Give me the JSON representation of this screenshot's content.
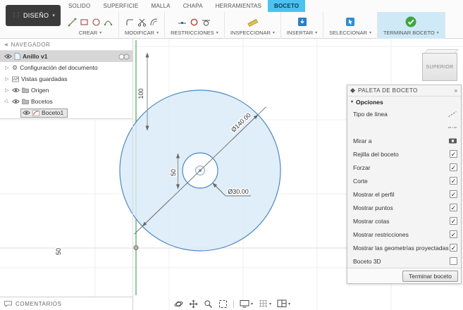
{
  "design_button": "DISEÑO",
  "tabs": [
    "SOLIDO",
    "SUPERFICIE",
    "MALLA",
    "CHAPA",
    "HERRAMIENTAS",
    "BOCETO"
  ],
  "active_tab": "BOCETO",
  "toolbar": {
    "groups": [
      {
        "label": "CREAR",
        "icons": [
          "line-icon",
          "rectangle-icon",
          "circle-icon",
          "arc-icon"
        ]
      },
      {
        "label": "MODIFICAR",
        "icons": [
          "fillet-icon",
          "trim-scissors-icon",
          "offset-icon"
        ]
      },
      {
        "label": "RESTRICCIONES",
        "icons": [
          "midpoint-constraint-icon",
          "coincident-constraint-icon",
          "tangent-constraint-icon"
        ]
      },
      {
        "label": "INSPECCIONAR",
        "icons": [
          "measure-icon"
        ]
      },
      {
        "label": "INSERTAR",
        "icons": [
          "insert-icon"
        ]
      },
      {
        "label": "SELECCIONAR",
        "icons": [
          "select-cursor-icon"
        ]
      },
      {
        "label": "TERMINAR BOCETO",
        "icons": [
          "finish-sketch-check-icon"
        ],
        "highlighted": true
      }
    ]
  },
  "navigator": {
    "title": "NAVEGADOR",
    "items": [
      {
        "label": "Anillo v1",
        "selected": true,
        "icons": [
          "eye-icon",
          "document-icon"
        ]
      },
      {
        "label": "Configuración del documento",
        "icons": [
          "gear-icon"
        ]
      },
      {
        "label": "Vistas guardadas",
        "icons": [
          "saved-views-icon"
        ]
      },
      {
        "label": "Origen",
        "icons": [
          "eye-icon",
          "folder-icon"
        ]
      },
      {
        "label": "Bocetos",
        "expanded": true,
        "icons": [
          "eye-icon",
          "folder-icon"
        ]
      },
      {
        "label": "Boceto1",
        "depth": 1,
        "active": true,
        "icons": [
          "eye-icon",
          "sketch-icon"
        ]
      }
    ]
  },
  "comments": {
    "title": "COMENTARIOS"
  },
  "viewcube": {
    "face": "SUPERIOR"
  },
  "canvas": {
    "dimensions": {
      "outer_diameter": "Ø140.00",
      "inner_diameter": "Ø30.00",
      "vertical_100": "100",
      "vertical_50": "50",
      "bottom_50": "50"
    },
    "accent_colors": {
      "profile_fill": "#d9ebf7",
      "geometry_stroke": "#4e88c0",
      "y_axis": "#46a758"
    }
  },
  "palette": {
    "title": "PALETA DE BOCETO",
    "section_title": "Opciones",
    "rows": [
      {
        "label": "Tipo de línea",
        "control": "construction-line-icon"
      },
      {
        "label": "",
        "control": "center-line-icon"
      },
      {
        "label": "Mirar a",
        "control": "look-at-icon"
      },
      {
        "label": "Rejilla del boceto",
        "checked": true,
        "mark": "✓"
      },
      {
        "label": "Forzar",
        "checked": true,
        "mark": "✓"
      },
      {
        "label": "Corte",
        "checked": true,
        "mark": "✓"
      },
      {
        "label": "Mostrar el perfil",
        "checked": true,
        "mark": "✓"
      },
      {
        "label": "Mostrar puntos",
        "checked": true,
        "mark": "✓"
      },
      {
        "label": "Mostrar cotas",
        "checked": true,
        "mark": "✓"
      },
      {
        "label": "Mostrar restricciones",
        "checked": true,
        "mark": "✓"
      },
      {
        "label": "Mostrar las geometrías proyectadas",
        "checked": true,
        "mark": "✓"
      },
      {
        "label": "Boceto 3D",
        "checked": false,
        "mark": ""
      }
    ],
    "finish_button": "Terminar boceto"
  },
  "bottom_toolbar": {
    "icons": [
      "orbit-icon",
      "pan-icon",
      "zoom-icon",
      "fit-icon",
      "display-settings-icon",
      "grid-settings-icon",
      "viewports-icon"
    ]
  }
}
